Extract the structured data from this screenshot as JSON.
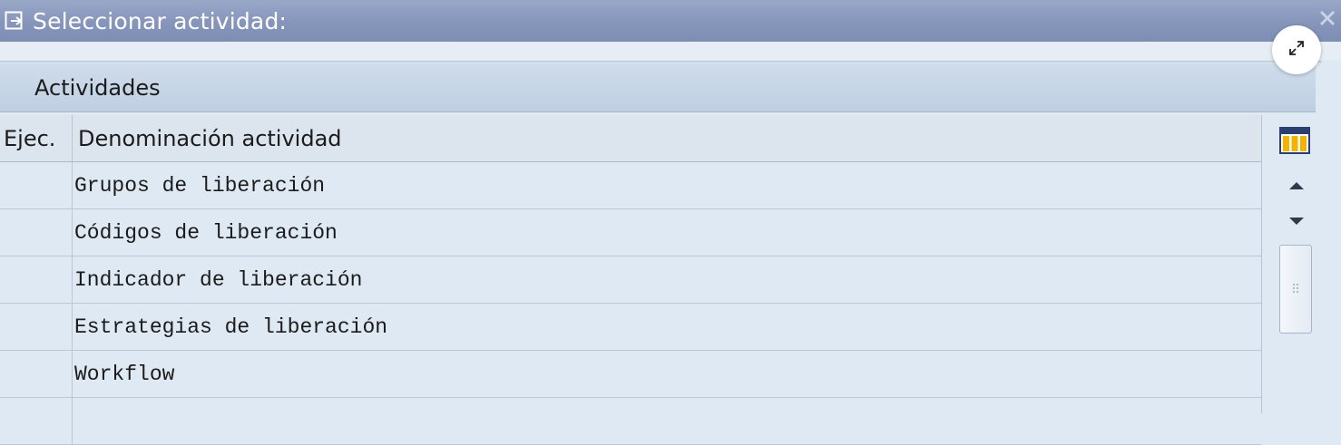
{
  "dialog": {
    "title": "Seleccionar actividad:",
    "close_icon": "close-icon",
    "title_icon": "dialog-select-icon"
  },
  "group": {
    "title": "Actividades"
  },
  "table": {
    "columns": [
      "Ejec.",
      "Denominación actividad"
    ],
    "rows": [
      {
        "ejec": "",
        "denominacion": "Grupos de liberación"
      },
      {
        "ejec": "",
        "denominacion": "Códigos de liberación"
      },
      {
        "ejec": "",
        "denominacion": "Indicador de liberación"
      },
      {
        "ejec": "",
        "denominacion": "Estrategias de liberación"
      },
      {
        "ejec": "",
        "denominacion": "Workflow"
      },
      {
        "ejec": "",
        "denominacion": ""
      }
    ]
  },
  "controls": {
    "column_settings_icon": "column-settings-icon",
    "scroll_up_icon": "scroll-up-icon",
    "scroll_down_icon": "scroll-down-icon",
    "expand_icon": "expand-icon"
  },
  "colors": {
    "titlebar": "#8796bb",
    "table_bg": "#dfe9f3",
    "header_bg": "#dce4ee"
  }
}
